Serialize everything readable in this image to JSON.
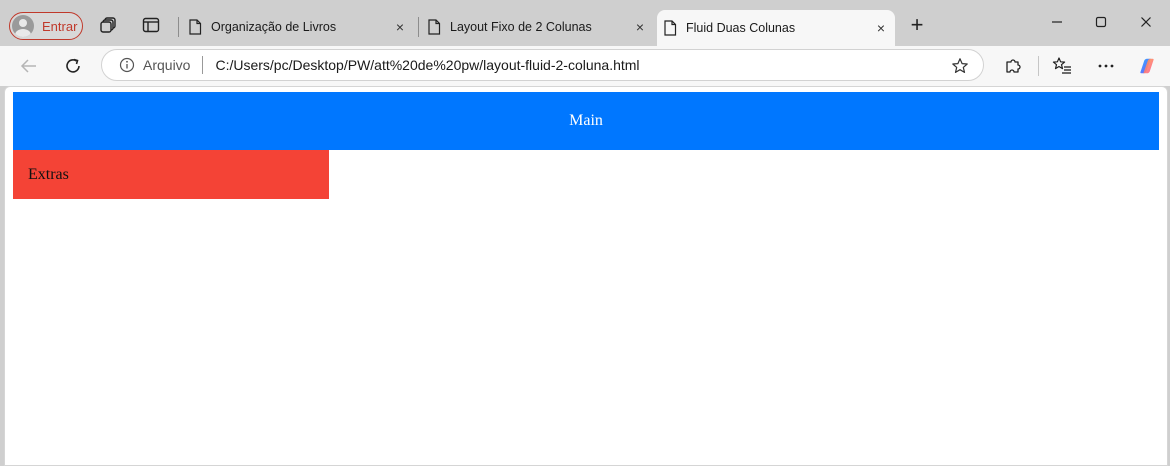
{
  "browser": {
    "profile_label": "Entrar",
    "tabs": [
      {
        "title": "Organização de Livros",
        "active": false
      },
      {
        "title": "Layout Fixo de 2 Colunas",
        "active": false
      },
      {
        "title": "Fluid Duas Colunas",
        "active": true
      }
    ],
    "close_glyph": "×",
    "new_tab_glyph": "+",
    "window_controls": {
      "minimize": "—",
      "maximize": "☐",
      "close": "✕"
    }
  },
  "toolbar": {
    "scheme_label": "Arquivo",
    "url": "C:/Users/pc/Desktop/PW/att%20de%20pw/layout-fluid-2-coluna.html"
  },
  "page": {
    "main_text": "Main",
    "extras_text": "Extras",
    "colors": {
      "main_bg": "#0077ff",
      "extras_bg": "#f44336"
    }
  },
  "icons": {
    "tab_actions": "tab-actions-icon",
    "vertical_tabs": "vertical-tabs-icon",
    "document": "document-icon",
    "back": "back-arrow-icon",
    "refresh": "refresh-icon",
    "info": "info-icon",
    "favorite": "star-icon",
    "extensions": "puzzle-icon",
    "favorites": "favorites-list-icon",
    "more": "more-icon",
    "copilot": "copilot-icon"
  }
}
